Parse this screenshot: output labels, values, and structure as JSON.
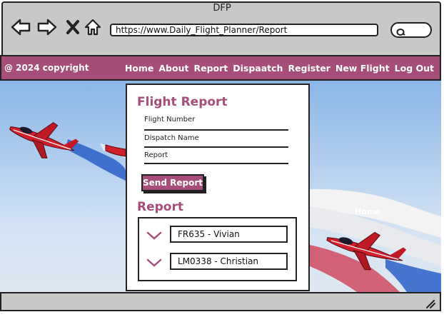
{
  "window": {
    "title": "DFP"
  },
  "browser": {
    "url": "https://www.Daily_Flight_Planner/Report"
  },
  "header": {
    "copyright": "@ 2024 copyright",
    "nav": [
      "Home",
      "About",
      "Report",
      "Dispaatch",
      "Register",
      "New Flight",
      "Log Out"
    ]
  },
  "form": {
    "title": "Flight Report",
    "fields": [
      "Flight Number",
      "Dispatch Name",
      "Report"
    ],
    "submit_label": "Send Report"
  },
  "report": {
    "title": "Report",
    "items": [
      "FR635 - Vivian",
      "LM0338 - Christian"
    ]
  },
  "hero_overlay_text": "Home",
  "colors": {
    "accent": "#a64d79",
    "sky": "#8ab6e6",
    "jet": "#d11f2c"
  }
}
